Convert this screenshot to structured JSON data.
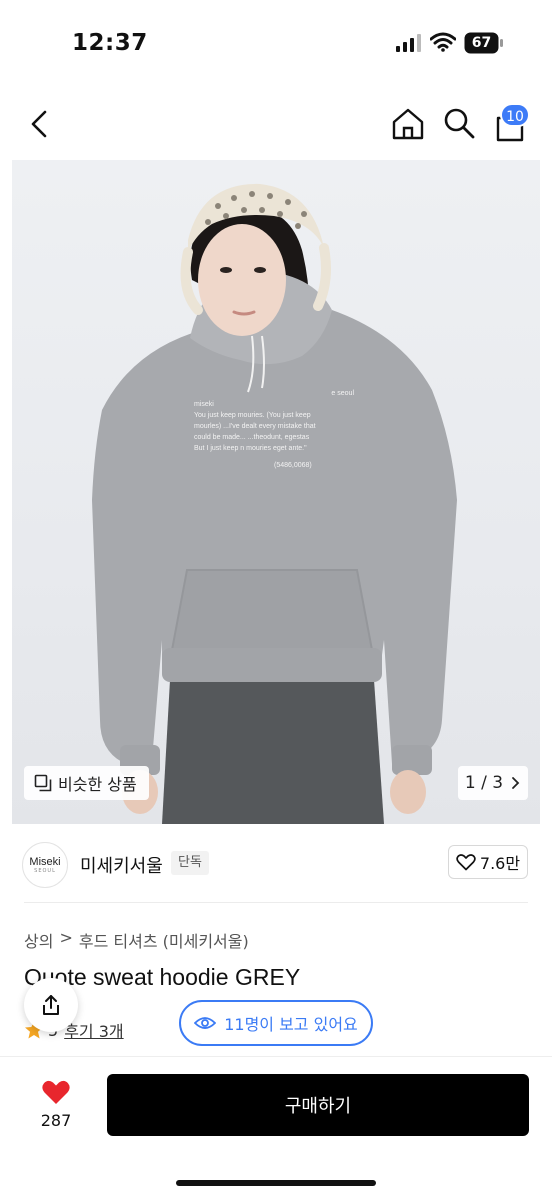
{
  "status": {
    "time": "12:37",
    "battery": "67"
  },
  "nav": {
    "cart_count": "10"
  },
  "gallery": {
    "similar_label": "비슷한 상품",
    "pager": "1 / 3",
    "print_text": [
      "miseki",
      "You just keep mouries.  (You just keep",
      "mourles) ...I've dealt every mistake that",
      "could be made...   ...theodunt, egestas",
      "But I just keep n mouries     eget ante.\"",
      "e seoul",
      "(5486,0068)"
    ]
  },
  "brand": {
    "logo_line1": "Miseki",
    "logo_line2": "SEOUL",
    "name": "미세키서울",
    "tag": "단독",
    "likes": "7.6만"
  },
  "breadcrumb": [
    "상의",
    ">",
    "후드 티셔츠 (미세키서울)"
  ],
  "product": {
    "title": "Quote sweat hoodie GREY",
    "rating": "5",
    "review_label": "후기 3개"
  },
  "viewers": {
    "label": "11명이 보고 있어요"
  },
  "bottom": {
    "heart_count": "287",
    "buy_label": "구매하기"
  },
  "colors": {
    "accent": "#3b7bf5",
    "badge": "#3d7bf7",
    "heart": "#e8262d",
    "star": "#f5a623"
  }
}
